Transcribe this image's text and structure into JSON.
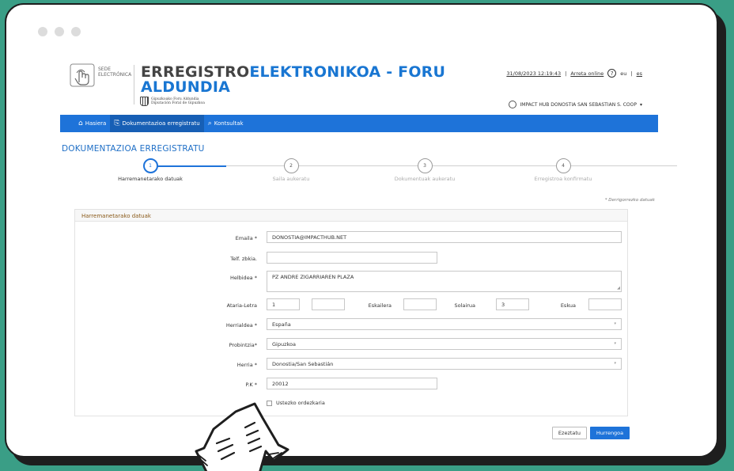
{
  "header": {
    "logo_text_1": "SEDE",
    "logo_text_2": "ELECTRÓNICA",
    "title_part1": "ERREGISTRO",
    "title_part2": "ELEKTRONIKOA - FORU",
    "title_line2": "ALDUNDIA",
    "crest_line1": "Gipuzkoako Foru Aldundia",
    "crest_line2": "Diputación Foral de Gipuzkoa",
    "datetime": "31/08/2023 12:19:43",
    "online_help": "Arreta online",
    "help_glyph": "?",
    "lang_eu": "eu",
    "lang_es": "es",
    "user_name": "IMPACT HUB DONOSTIA SAN SEBASTIAN S. COOP",
    "user_caret": "▾"
  },
  "nav": {
    "items": [
      {
        "label": "Hasiera",
        "icon": "home-icon",
        "glyph": "⌂"
      },
      {
        "label": "Dokumentazioa erregistratu",
        "icon": "document-icon",
        "glyph": "⎘"
      },
      {
        "label": "Kontsultak",
        "icon": "search-icon",
        "glyph": "⌕"
      }
    ]
  },
  "section_title": "DOKUMENTAZIOA ERREGISTRATU",
  "steps": [
    {
      "num": "1",
      "label": "Harremanetarako datuak"
    },
    {
      "num": "2",
      "label": "Saila aukeratu"
    },
    {
      "num": "3",
      "label": "Dokumentuak aukeratu"
    },
    {
      "num": "4",
      "label": "Erregistroa konfirmatu"
    }
  ],
  "steps_progress": 0.33,
  "required_note": "* Derrigorrezko datuak",
  "form": {
    "panel_title": "Harremanetarako datuak",
    "email_label": "Emaila *",
    "email_value": "DONOSTIA@IMPACTHUB.NET",
    "phone_label": "Telf. zbkia.",
    "phone_value": "",
    "address_label": "Helbidea *",
    "address_value": "PZ ANDRE ZIGARRIAREN PLAZA",
    "portal_label": "Ataria-Letra",
    "portal_value": "1",
    "letter_value": "",
    "stairs_label": "Eskailera",
    "stairs_value": "",
    "floor_label": "Solairua",
    "floor_value": "3",
    "hand_label": "Eskua",
    "hand_value": "",
    "country_label": "Herrialdea *",
    "country_value": "España",
    "province_label": "Probintzia*",
    "province_value": "Gipuzkoa",
    "town_label": "Herria *",
    "town_value": "Donostia/San Sebastián",
    "postcode_label": "P.K *",
    "postcode_value": "20012",
    "representative_label": "Ustezko ordezkaria",
    "select_arrow": "▾",
    "resize_glyph": "◢"
  },
  "buttons": {
    "cancel": "Ezeztatu",
    "next": "Hurrengoa"
  },
  "colors": {
    "primary": "#1e73d9",
    "background": "#3a9e86",
    "panel_title": "#8a5a1a"
  }
}
